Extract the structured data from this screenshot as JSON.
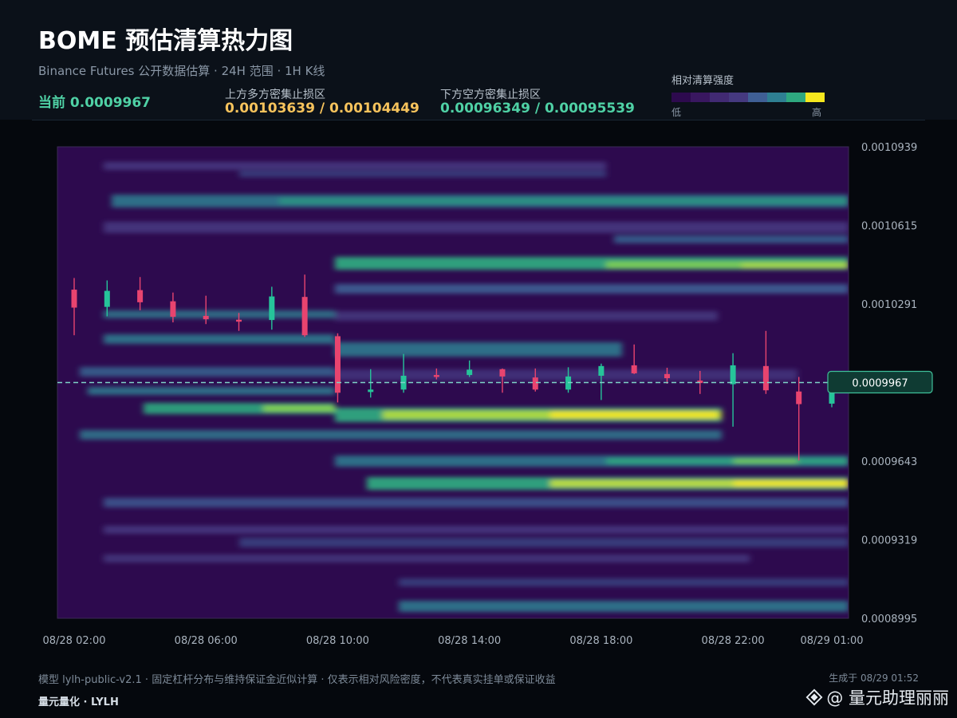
{
  "header": {
    "title": "BOME 预估清算热力图",
    "subtitle": "Binance Futures 公开数据估算 · 24H 范围 · 1H K线",
    "current_label": "当前 0.0009967",
    "upper_zone_label": "上方多方密集止损区",
    "upper_zone_value": "0.00103639 / 0.00104449",
    "lower_zone_label": "下方空方密集止损区",
    "lower_zone_value": "0.00096349 / 0.00095539"
  },
  "legend": {
    "title": "相对清算强度",
    "low": "低",
    "high": "高",
    "colors": [
      "#2d0a4e",
      "#391760",
      "#412a73",
      "#45397f",
      "#3f5f95",
      "#2e7f92",
      "#2ea87f",
      "#f6e71e"
    ]
  },
  "colors": {
    "bull": "#26c49a",
    "bear": "#e8446f",
    "current_line": "#7fd3c8",
    "tag_bg": "#0f3b33",
    "tag_border": "#3fbf99",
    "accent_upper": "#f6c35c",
    "accent_lower": "#4fd1a5"
  },
  "chart_data": {
    "type": "heatmap",
    "title": "BOME 预估清算热力图",
    "x_range": [
      "08/28 02:00",
      "08/29 01:00"
    ],
    "x_tick_labels": [
      "08/28 02:00",
      "08/28 06:00",
      "08/28 10:00",
      "08/28 14:00",
      "08/28 18:00",
      "08/28 22:00",
      "08/29 01:00"
    ],
    "x_tick_hours": [
      0,
      4,
      8,
      12,
      16,
      20,
      23
    ],
    "ylim": [
      0.0008995,
      0.0010939
    ],
    "y_tick_labels": [
      "0.0010939",
      "0.0010615",
      "0.0010291",
      "0.0009643",
      "0.0009319",
      "0.0008995"
    ],
    "y_ticks": [
      0.0010939,
      0.0010615,
      0.0010291,
      0.0009643,
      0.0009319,
      0.0008995
    ],
    "current_price": 0.0009967,
    "current_price_label": "0.0009967",
    "candles": [
      {
        "t": 0,
        "o": 0.001035,
        "h": 0.0010398,
        "l": 0.0010162,
        "c": 0.0010276
      },
      {
        "t": 1,
        "o": 0.0010279,
        "h": 0.0010388,
        "l": 0.001024,
        "c": 0.0010345
      },
      {
        "t": 2,
        "o": 0.0010348,
        "h": 0.0010402,
        "l": 0.0010265,
        "c": 0.0010298
      },
      {
        "t": 3,
        "o": 0.0010302,
        "h": 0.0010338,
        "l": 0.0010215,
        "c": 0.0010238
      },
      {
        "t": 4,
        "o": 0.0010242,
        "h": 0.0010325,
        "l": 0.0010208,
        "c": 0.0010228
      },
      {
        "t": 5,
        "o": 0.0010226,
        "h": 0.0010254,
        "l": 0.001018,
        "c": 0.0010218
      },
      {
        "t": 6,
        "o": 0.0010225,
        "h": 0.0010362,
        "l": 0.0010185,
        "c": 0.0010322
      },
      {
        "t": 7,
        "o": 0.001032,
        "h": 0.0010412,
        "l": 0.0010155,
        "c": 0.0010162
      },
      {
        "t": 8,
        "o": 0.0010158,
        "h": 0.001017,
        "l": 0.0009885,
        "c": 0.0009925
      },
      {
        "t": 9,
        "o": 0.0009928,
        "h": 0.0010022,
        "l": 0.0009905,
        "c": 0.0009938
      },
      {
        "t": 10,
        "o": 0.0009938,
        "h": 0.0010085,
        "l": 0.0009925,
        "c": 0.0009995
      },
      {
        "t": 11,
        "o": 0.0009998,
        "h": 0.0010025,
        "l": 0.000998,
        "c": 0.000999
      },
      {
        "t": 12,
        "o": 0.0009998,
        "h": 0.0010058,
        "l": 0.000999,
        "c": 0.001002
      },
      {
        "t": 13,
        "o": 0.0010022,
        "h": 0.0010025,
        "l": 0.0009925,
        "c": 0.0009992
      },
      {
        "t": 14,
        "o": 0.0009988,
        "h": 0.0010025,
        "l": 0.000993,
        "c": 0.0009938
      },
      {
        "t": 15,
        "o": 0.0009938,
        "h": 0.001003,
        "l": 0.0009925,
        "c": 0.0009992
      },
      {
        "t": 16,
        "o": 0.0009995,
        "h": 0.0010045,
        "l": 0.0009895,
        "c": 0.0010035
      },
      {
        "t": 17,
        "o": 0.0010038,
        "h": 0.0010124,
        "l": 0.0010002,
        "c": 0.0010005
      },
      {
        "t": 18,
        "o": 0.0010002,
        "h": 0.0010028,
        "l": 0.0009962,
        "c": 0.0009985
      },
      {
        "t": 19,
        "o": 0.0009975,
        "h": 0.0010015,
        "l": 0.000992,
        "c": 0.0009965
      },
      {
        "t": 20,
        "o": 0.000996,
        "h": 0.0010088,
        "l": 0.0009785,
        "c": 0.0010038
      },
      {
        "t": 21,
        "o": 0.0010035,
        "h": 0.001018,
        "l": 0.000992,
        "c": 0.0009935
      },
      {
        "t": 22,
        "o": 0.000993,
        "h": 0.000999,
        "l": 0.0009646,
        "c": 0.0009878
      },
      {
        "t": 23,
        "o": 0.000988,
        "h": 0.0009978,
        "l": 0.0009865,
        "c": 0.0009942
      }
    ]
  },
  "footer": {
    "note": "模型 lylh-public-v2.1 · 固定杠杆分布与维持保证金近似计算 · 仅表示相对风险密度，不代表真实挂单或保证收益",
    "brand": "量元量化 · LYLH",
    "generated": "生成于 08/29 01:52",
    "watermark": "@ 量元助理丽丽"
  }
}
